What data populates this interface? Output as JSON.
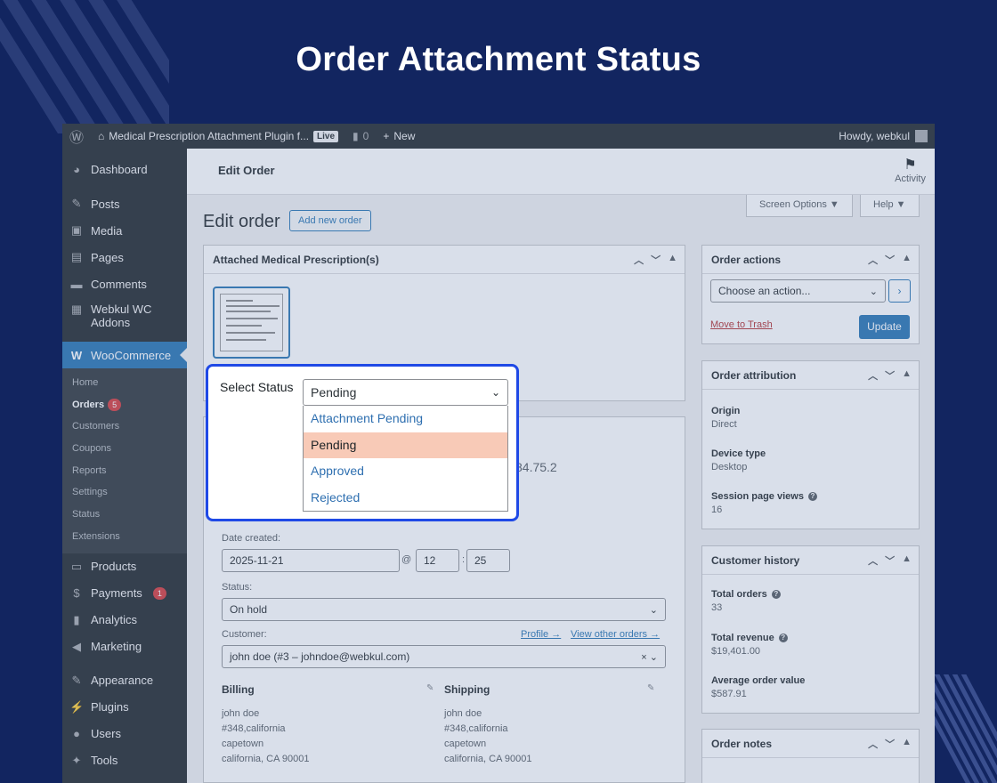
{
  "banner": {
    "title": "Order Attachment Status"
  },
  "adminbar": {
    "site_name": "Medical Prescription Attachment Plugin f...",
    "live_label": "Live",
    "comments_count": "0",
    "new_label": "New",
    "howdy": "Howdy, webkul"
  },
  "sidebar": {
    "items_top": [
      {
        "label": "Dashboard",
        "icon": "dashboard-icon"
      },
      {
        "label": "Posts",
        "icon": "pin-icon"
      },
      {
        "label": "Media",
        "icon": "media-icon"
      },
      {
        "label": "Pages",
        "icon": "pages-icon"
      },
      {
        "label": "Comments",
        "icon": "comments-icon"
      },
      {
        "label": "Webkul WC Addons",
        "icon": "addons-icon"
      }
    ],
    "woocommerce": "WooCommerce",
    "submenu": [
      "Home",
      "Orders",
      "Customers",
      "Coupons",
      "Reports",
      "Settings",
      "Status",
      "Extensions"
    ],
    "orders_badge": "5",
    "items_bottom": [
      {
        "label": "Products",
        "icon": "products-icon"
      },
      {
        "label": "Payments",
        "icon": "payments-icon"
      },
      {
        "label": "Analytics",
        "icon": "analytics-icon"
      },
      {
        "label": "Marketing",
        "icon": "marketing-icon"
      },
      {
        "label": "Appearance",
        "icon": "appearance-icon"
      },
      {
        "label": "Plugins",
        "icon": "plugins-icon"
      },
      {
        "label": "Users",
        "icon": "users-icon"
      },
      {
        "label": "Tools",
        "icon": "tools-icon"
      }
    ],
    "payments_badge": "1"
  },
  "topbar": {
    "title": "Edit Order",
    "activity": "Activity"
  },
  "screen_options": "Screen Options ▼",
  "help": "Help ▼",
  "page": {
    "title": "Edit order",
    "add_new": "Add new order"
  },
  "attached": {
    "title": "Attached Medical Prescription(s)"
  },
  "popup": {
    "label": "Select Status",
    "selected": "Pending",
    "options": [
      "Attachment Pending",
      "Pending",
      "Approved",
      "Rejected"
    ]
  },
  "order": {
    "partial_ip": "84.75.2",
    "date_label": "Date created:",
    "date": "2025-11-21",
    "hour": "12",
    "minute": "25",
    "status_label": "Status:",
    "status": "On hold",
    "customer_label": "Customer:",
    "profile_link": "Profile →",
    "other_orders_link": "View other orders →",
    "customer": "john doe (#3 – johndoe@webkul.com)",
    "billing_title": "Billing",
    "billing": [
      "john doe",
      "#348,california",
      "capetown",
      "california, CA 90001"
    ],
    "shipping_title": "Shipping",
    "shipping": [
      "john doe",
      "#348,california",
      "capetown",
      "california, CA 90001"
    ]
  },
  "order_actions": {
    "title": "Order actions",
    "select": "Choose an action...",
    "trash": "Move to Trash",
    "update": "Update"
  },
  "attribution": {
    "title": "Order attribution",
    "origin_k": "Origin",
    "origin_v": "Direct",
    "device_k": "Device type",
    "device_v": "Desktop",
    "views_k": "Session page views",
    "views_v": "16"
  },
  "history": {
    "title": "Customer history",
    "total_orders_k": "Total orders",
    "total_orders_v": "33",
    "revenue_k": "Total revenue",
    "revenue_v": "$19,401.00",
    "avg_k": "Average order value",
    "avg_v": "$587.91"
  },
  "notes": {
    "title": "Order notes"
  }
}
